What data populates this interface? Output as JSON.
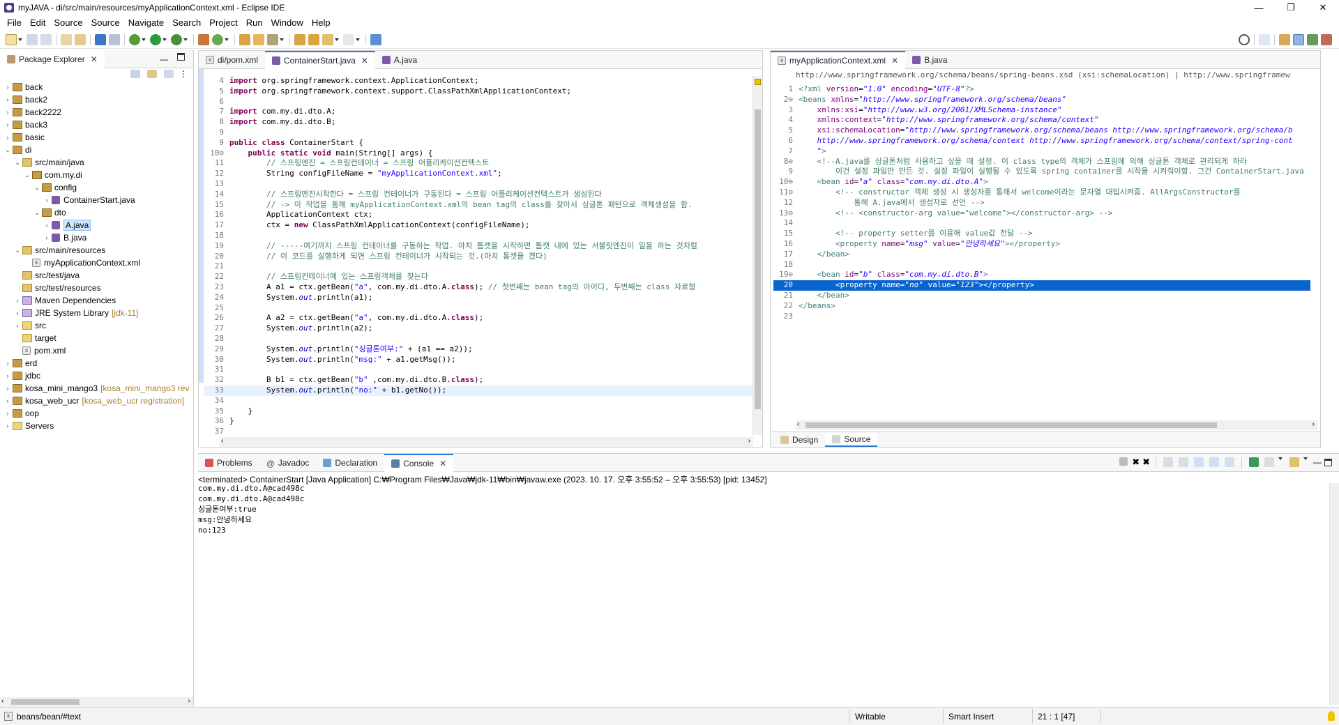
{
  "window": {
    "title": "myJAVA - di/src/main/resources/myApplicationContext.xml - Eclipse IDE",
    "min": "—",
    "max": "❐",
    "close": "✕"
  },
  "menu": [
    "File",
    "Edit",
    "Source",
    "Source",
    "Navigate",
    "Search",
    "Project",
    "Run",
    "Window",
    "Help"
  ],
  "package_explorer": {
    "title": "Package Explorer",
    "items": [
      {
        "depth": 0,
        "arrow": "›",
        "icon": "proj",
        "label": "back"
      },
      {
        "depth": 0,
        "arrow": "›",
        "icon": "proj",
        "label": "back2"
      },
      {
        "depth": 0,
        "arrow": "›",
        "icon": "proj",
        "label": "back2222"
      },
      {
        "depth": 0,
        "arrow": "›",
        "icon": "proj",
        "label": "back3"
      },
      {
        "depth": 0,
        "arrow": "›",
        "icon": "proj",
        "label": "basic"
      },
      {
        "depth": 0,
        "arrow": "⌄",
        "icon": "proj",
        "label": "di"
      },
      {
        "depth": 1,
        "arrow": "⌄",
        "icon": "srcf",
        "label": "src/main/java"
      },
      {
        "depth": 2,
        "arrow": "⌄",
        "icon": "pkg",
        "label": "com.my.di"
      },
      {
        "depth": 3,
        "arrow": "⌄",
        "icon": "pkg",
        "label": "config"
      },
      {
        "depth": 4,
        "arrow": "›",
        "icon": "java",
        "label": "ContainerStart.java"
      },
      {
        "depth": 3,
        "arrow": "⌄",
        "icon": "pkg",
        "label": "dto"
      },
      {
        "depth": 4,
        "arrow": "›",
        "icon": "java",
        "label": "A.java",
        "selected": true
      },
      {
        "depth": 4,
        "arrow": "›",
        "icon": "java",
        "label": "B.java"
      },
      {
        "depth": 1,
        "arrow": "⌄",
        "icon": "srcf",
        "label": "src/main/resources"
      },
      {
        "depth": 2,
        "arrow": "",
        "icon": "xml",
        "label": "myApplicationContext.xml"
      },
      {
        "depth": 1,
        "arrow": "",
        "icon": "srcf",
        "label": "src/test/java"
      },
      {
        "depth": 1,
        "arrow": "",
        "icon": "srcf",
        "label": "src/test/resources"
      },
      {
        "depth": 1,
        "arrow": "›",
        "icon": "lib",
        "label": "Maven Dependencies"
      },
      {
        "depth": 1,
        "arrow": "›",
        "icon": "lib",
        "label": "JRE System Library",
        "deco": "[jdk-11]"
      },
      {
        "depth": 1,
        "arrow": "›",
        "icon": "fold",
        "label": "src"
      },
      {
        "depth": 1,
        "arrow": "",
        "icon": "fold",
        "label": "target"
      },
      {
        "depth": 1,
        "arrow": "",
        "icon": "xml",
        "label": "pom.xml"
      },
      {
        "depth": 0,
        "arrow": "›",
        "icon": "proj",
        "label": "erd"
      },
      {
        "depth": 0,
        "arrow": "›",
        "icon": "proj",
        "label": "jdbc"
      },
      {
        "depth": 0,
        "arrow": "›",
        "icon": "proj",
        "label": "kosa_mini_mango3",
        "deco": "[kosa_mini_mango3 rev"
      },
      {
        "depth": 0,
        "arrow": "›",
        "icon": "proj",
        "label": "kosa_web_ucr",
        "deco": "[kosa_web_ucr registration]"
      },
      {
        "depth": 0,
        "arrow": "›",
        "icon": "proj",
        "label": "oop"
      },
      {
        "depth": 0,
        "arrow": "›",
        "icon": "fold",
        "label": "Servers"
      }
    ]
  },
  "editor1": {
    "tabs": [
      {
        "label": "di/pom.xml",
        "icon": "xml"
      },
      {
        "label": "ContainerStart.java",
        "icon": "java",
        "active": true
      },
      {
        "label": "A.java",
        "icon": "java"
      }
    ],
    "lines": [
      {
        "n": "4",
        "html": "<span class='kw'>import</span> org.springframework.context.ApplicationContext;"
      },
      {
        "n": "5",
        "html": "<span class='kw'>import</span> org.springframework.context.support.ClassPathXmlApplicationContext;"
      },
      {
        "n": "6",
        "html": ""
      },
      {
        "n": "7",
        "html": "<span class='kw'>import</span> com.my.di.dto.A;"
      },
      {
        "n": "8",
        "html": "<span class='kw'>import</span> com.my.di.dto.B;"
      },
      {
        "n": "9",
        "html": ""
      },
      {
        "n": "9",
        "html": "<span class='kw'>public class</span> ContainerStart {"
      },
      {
        "n": "10⊖",
        "html": "    <span class='kw'>public static void</span> main(String[] args) {"
      },
      {
        "n": "11",
        "html": "        <span class='cm'>// 스프링엔진 = 스프링컨테이너 = 스프링 어플리케이션컨텍스트</span>"
      },
      {
        "n": "12",
        "html": "        String configFileName = <span class='st'>\"myApplicationContext.xml\"</span>;"
      },
      {
        "n": "13",
        "html": ""
      },
      {
        "n": "14",
        "html": "        <span class='cm'>// 스프링엔진시작한다 = 스프링 컨테이너가 구동된다 = 스프링 어플리케이션컨텍스트가 생성된다</span>"
      },
      {
        "n": "15",
        "html": "        <span class='cm'>// -> 이 작업을 통해 myApplicationContext.xml의 bean tag의 class를 찾아서 싱글톤 패턴으로 객체생성을 함.</span>"
      },
      {
        "n": "16",
        "html": "        ApplicationContext ctx;"
      },
      {
        "n": "17",
        "html": "        ctx = <span class='kw'>new</span> ClassPathXmlApplicationContext(configFileName);"
      },
      {
        "n": "18",
        "html": ""
      },
      {
        "n": "19",
        "html": "        <span class='cm'>// -----여기까지 스프링 컨테이너를 구동하는 작업. 마치 톰캣을 시작하면 톰캣 내에 있는 서블릿엔진이 일을 하는 것처럼</span>"
      },
      {
        "n": "20",
        "html": "        <span class='cm'>// 이 코드를 실행하게 되면 스프링 컨테이너가 시작되는 것.(마치 톰캣을 켰다)</span>"
      },
      {
        "n": "21",
        "html": ""
      },
      {
        "n": "22",
        "html": "        <span class='cm'>// 스프링컨테이너에 있는 스프링객체를 찾는다</span>"
      },
      {
        "n": "23",
        "html": "        A a1 = ctx.getBean(<span class='st'>\"a\"</span>, com.my.di.dto.A.<span class='kw'>class</span>); <span class='cm'>// 첫번째는 bean tag의 아이디, 두번째는 class 자료형</span>"
      },
      {
        "n": "24",
        "html": "        System.<span class='fld'>out</span>.println(a1);"
      },
      {
        "n": "25",
        "html": ""
      },
      {
        "n": "26",
        "html": "        A a2 = ctx.getBean(<span class='st'>\"a\"</span>, com.my.di.dto.A.<span class='kw'>class</span>);"
      },
      {
        "n": "27",
        "html": "        System.<span class='fld'>out</span>.println(a2);"
      },
      {
        "n": "28",
        "html": ""
      },
      {
        "n": "29",
        "html": "        System.<span class='fld'>out</span>.println(<span class='st'>\"싱글톤여부:\"</span> + (a1 == a2));"
      },
      {
        "n": "30",
        "html": "        System.<span class='fld'>out</span>.println(<span class='st'>\"msg:\"</span> + a1.getMsg());"
      },
      {
        "n": "31",
        "html": ""
      },
      {
        "n": "32",
        "html": "        B b1 = ctx.getBean(<span class='st'>\"b\"</span> ,com.my.di.dto.B.<span class='kw'>class</span>);"
      },
      {
        "n": "33",
        "html": "        System.<span class='fld'>out</span>.println(<span class='st'>\"no:\"</span> + b1.getNo());",
        "current": true
      },
      {
        "n": "34",
        "html": ""
      },
      {
        "n": "35",
        "html": "    }"
      },
      {
        "n": "36",
        "html": "}"
      },
      {
        "n": "37",
        "html": ""
      }
    ]
  },
  "editor2": {
    "tabs": [
      {
        "label": "myApplicationContext.xml",
        "icon": "xml",
        "active": true
      },
      {
        "label": "B.java",
        "icon": "java"
      }
    ],
    "breadcrumb": "http://www.springframework.org/schema/beans/spring-beans.xsd (xsi:schemaLocation) | http://www.springframew",
    "lines": [
      {
        "n": "1",
        "html": "<span class='tag'>&lt;?xml</span> <span class='attr'>version</span>=<span class='aval'>\"1.0\"</span> <span class='attr'>encoding</span>=<span class='aval'>\"UTF-8\"</span><span class='tag'>?&gt;</span>"
      },
      {
        "n": "2⊖",
        "html": "<span class='tag'>&lt;beans</span> <span class='attr'>xmlns</span>=<span class='aval'>\"http://www.springframework.org/schema/beans\"</span>"
      },
      {
        "n": "3",
        "html": "    <span class='attr'>xmlns:xsi</span>=<span class='aval'>\"http://www.w3.org/2001/XMLSchema-instance\"</span>"
      },
      {
        "n": "4",
        "html": "    <span class='attr'>xmlns:context</span>=<span class='aval'>\"http://www.springframework.org/schema/context\"</span>"
      },
      {
        "n": "5",
        "html": "    <span class='attr'>xsi:schemaLocation</span>=<span class='aval'>\"http://www.springframework.org/schema/beans http://www.springframework.org/schema/b</span>"
      },
      {
        "n": "6",
        "html": "    <span class='aval'>http://www.springframework.org/schema/context http://www.springframework.org/schema/context/spring-cont</span>"
      },
      {
        "n": "7",
        "html": "    <span class='aval'>\"</span><span class='tag'>&gt;</span>"
      },
      {
        "n": "8⊖",
        "html": "    <span class='cm'>&lt;!--A.java를 싱글톤처럼 사용하고 싶을 때 설정. 이 class type의 객체가 스프링에 의해 싱글톤 객체로 관리되게 하라</span>"
      },
      {
        "n": "9",
        "html": "    <span class='cm'>    이건 설정 파일만 만든 것. 설정 파일이 실행될 수 있도록 spring container를 시작을 시켜줘야함. 그건 ContainerStart.java</span>"
      },
      {
        "n": "10⊖",
        "html": "    <span class='tag'>&lt;bean</span> <span class='attr'>id</span>=<span class='aval'>\"a\"</span> <span class='attr'>class</span>=<span class='aval'>\"com.my.di.dto.A\"</span><span class='tag'>&gt;</span>"
      },
      {
        "n": "11⊖",
        "html": "        <span class='cm'>&lt;!-- constructor 객체 생성 시 생성자를 통해서 welcome이라는 문자열 대입시켜줌. AllArgsConstructor를</span>"
      },
      {
        "n": "12",
        "html": "        <span class='cm'>    통해 A.java에서 생성자로 선언 --&gt;</span>"
      },
      {
        "n": "13⊖",
        "html": "        <span class='cm'>&lt;!-- &lt;constructor-arg value=\"welcome\"&gt;&lt;/constructor-arg&gt; --&gt;</span>"
      },
      {
        "n": "14",
        "html": ""
      },
      {
        "n": "15",
        "html": "        <span class='cm'>&lt;!-- property setter를 이용해 value값 전달 --&gt;</span>"
      },
      {
        "n": "16",
        "html": "        <span class='tag'>&lt;property</span> <span class='attr'>name</span>=<span class='aval'>\"msg\"</span> <span class='attr'>value</span>=<span class='aval'>\"안녕하세요\"</span><span class='tag'>&gt;&lt;/property&gt;</span>"
      },
      {
        "n": "17",
        "html": "    <span class='tag'>&lt;/bean&gt;</span>"
      },
      {
        "n": "18",
        "html": ""
      },
      {
        "n": "19⊖",
        "html": "    <span class='tag'>&lt;bean</span> <span class='attr'>id</span>=<span class='aval'>\"b\"</span> <span class='attr'>class</span>=<span class='aval'>\"com.my.di.dto.B\"</span><span class='tag'>&gt;</span>"
      },
      {
        "n": "20",
        "html": "        <span class='tag'>&lt;property</span> <span class='attr'>name</span>=<span class='aval'>\"no\"</span> <span class='attr'>value</span>=<span class='aval'>\"123\"</span><span class='tag'>&gt;&lt;/property&gt;</span>",
        "selected": true
      },
      {
        "n": "21",
        "html": "    <span class='tag'>&lt;/bean&gt;</span>"
      },
      {
        "n": "22",
        "html": "<span class='tag'>&lt;/beans&gt;</span>"
      },
      {
        "n": "23",
        "html": ""
      }
    ],
    "bottom_tabs": [
      "Design",
      "Source"
    ]
  },
  "console": {
    "tabs": [
      {
        "label": "Problems"
      },
      {
        "label": "Javadoc"
      },
      {
        "label": "Declaration"
      },
      {
        "label": "Console",
        "active": true
      }
    ],
    "header": "<terminated> ContainerStart [Java Application] C:₩Program Files₩Java₩jdk-11₩bin₩javaw.exe  (2023. 10. 17. 오후 3:55:52 – 오후 3:55:53) [pid: 13452]",
    "output": [
      "com.my.di.dto.A@cad498c",
      "com.my.di.dto.A@cad498c",
      "싱글톤여부:true",
      "msg:안녕하세요",
      "no:123"
    ]
  },
  "status": {
    "path": "beans/bean/#text",
    "mode": "Writable",
    "insert": "Smart Insert",
    "pos": "21 : 1 [47]"
  }
}
